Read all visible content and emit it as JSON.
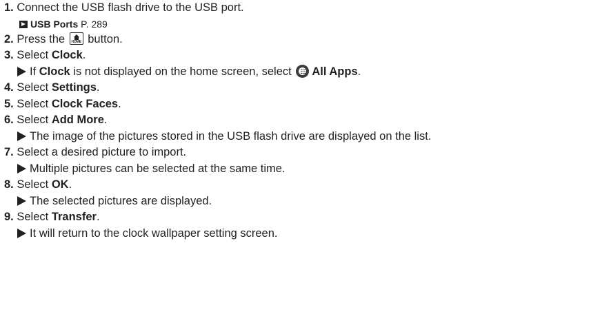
{
  "steps": {
    "s1": {
      "num": "1.",
      "text": "Connect the USB flash drive to the USB port."
    },
    "s1_ref": {
      "link": "USB Ports",
      "page": "P. 289"
    },
    "s2": {
      "num": "2.",
      "pre": "Press the",
      "post": "button.",
      "icon_label": "HOME",
      "icon": "home-icon"
    },
    "s3": {
      "num": "3.",
      "pre": "Select",
      "bold": "Clock",
      "post": "."
    },
    "s3_sub": {
      "pre": "If",
      "bold1": "Clock",
      "mid": "is not displayed on the home screen, select",
      "icon": "all-apps-icon",
      "bold2": "All Apps",
      "post": "."
    },
    "s4": {
      "num": "4.",
      "pre": "Select",
      "bold": "Settings",
      "post": "."
    },
    "s5": {
      "num": "5.",
      "pre": "Select",
      "bold": "Clock Faces",
      "post": "."
    },
    "s6": {
      "num": "6.",
      "pre": "Select",
      "bold": "Add More",
      "post": "."
    },
    "s6_sub": {
      "text": "The image of the pictures stored in the USB flash drive are displayed on the list."
    },
    "s7": {
      "num": "7.",
      "text": "Select a desired picture to import."
    },
    "s7_sub": {
      "text": "Multiple pictures can be selected at the same time."
    },
    "s8": {
      "num": "8.",
      "pre": "Select",
      "bold": "OK",
      "post": "."
    },
    "s8_sub": {
      "text": "The selected pictures are displayed."
    },
    "s9": {
      "num": "9.",
      "pre": "Select",
      "bold": "Transfer",
      "post": "."
    },
    "s9_sub": {
      "text": "It will return to the clock wallpaper setting screen."
    }
  }
}
